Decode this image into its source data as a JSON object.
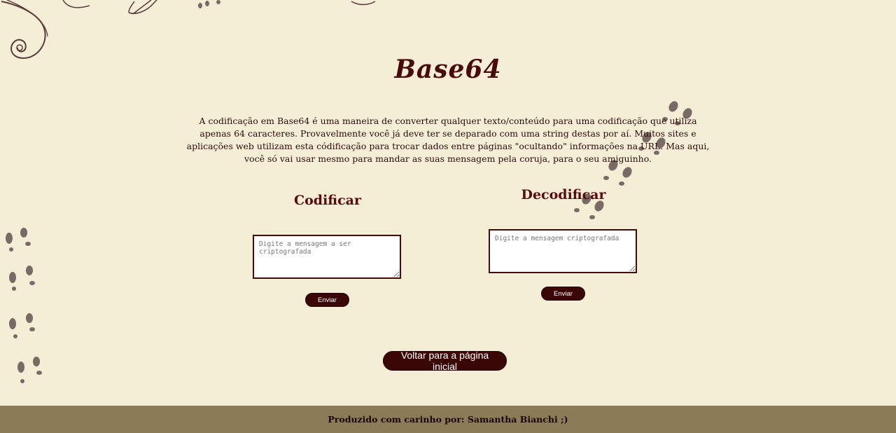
{
  "page": {
    "title": "Base64",
    "description": "A codificação em Base64 é uma maneira de converter qualquer texto/conteúdo para uma codificação que utiliza apenas 64 caracteres. Provavelmente você já deve ter se deparado com uma string destas por aí. Muitos sites e aplicações web utilizam esta códificação para trocar dados entre páginas \"ocultando\" informações na URL. Mas aqui, você só vai usar mesmo para mandar as suas mensagem pela coruja, para o seu amiguinho."
  },
  "encode": {
    "title": "Codificar",
    "placeholder": "Digite a mensagem a ser criptografada",
    "value": "",
    "button_label": "Enviar"
  },
  "decode": {
    "title": "Decodificar",
    "placeholder": "Digite a mensagem criptografada",
    "value": "",
    "button_label": "Enviar"
  },
  "back_button_label": "Voltar para a página inicial",
  "footer": {
    "text": "Produzido com carinho por: Samantha Bianchi ;)"
  },
  "colors": {
    "background": "#f4eed6",
    "primary": "#3a0606",
    "footer": "#8b7b56",
    "pawprint": "#7a6a66"
  },
  "icons": [
    "swirl-ornament",
    "paw-print-trail"
  ]
}
